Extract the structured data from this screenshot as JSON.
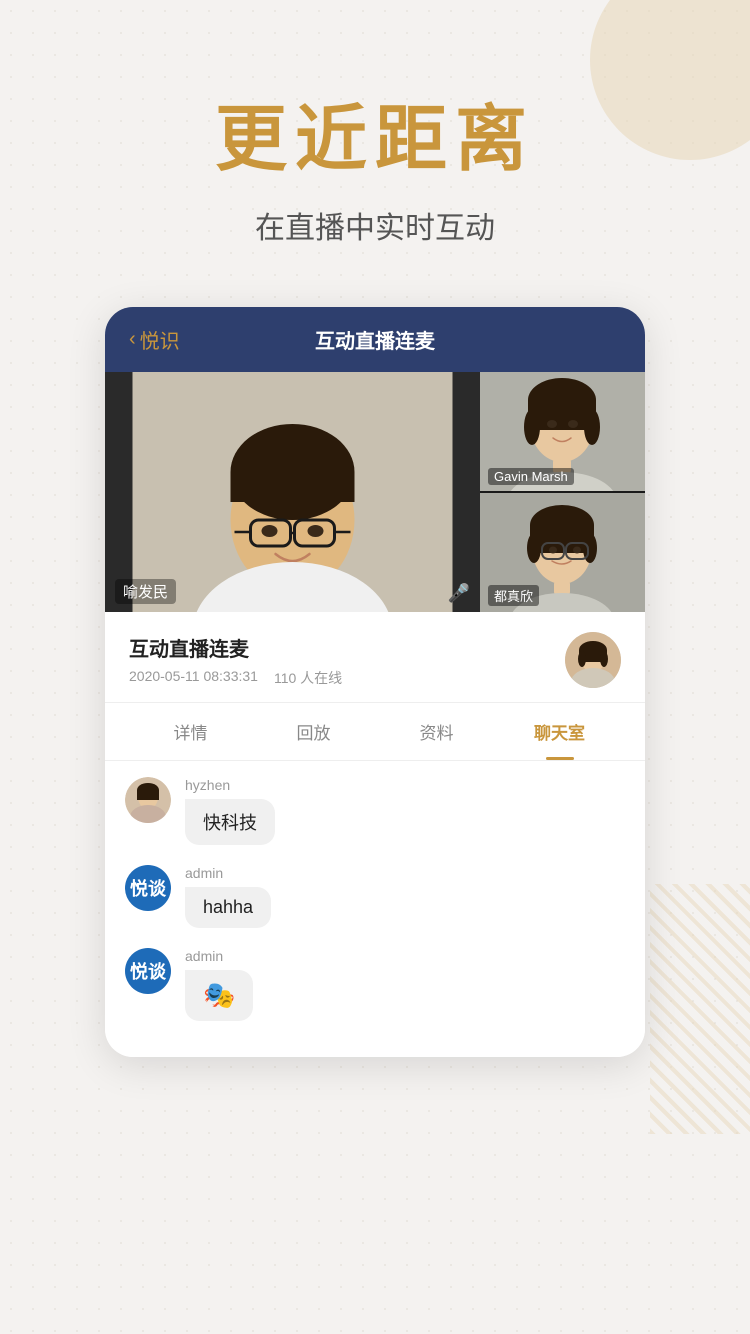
{
  "page": {
    "bg_color": "#f4f2f0"
  },
  "hero": {
    "main_title": "更近距离",
    "sub_title": "在直播中实时互动"
  },
  "card": {
    "header": {
      "back_label": "悦识",
      "title": "互动直播连麦"
    },
    "video": {
      "main_person": {
        "name": "喻发民",
        "has_mic": true
      },
      "side_persons": [
        {
          "name": "Gavin Marsh"
        },
        {
          "name": "都真欣"
        }
      ]
    },
    "info": {
      "title": "互动直播连麦",
      "date": "2020-05-11 08:33:31",
      "online_count": "110 人在线"
    },
    "tabs": [
      {
        "label": "详情",
        "active": false
      },
      {
        "label": "回放",
        "active": false
      },
      {
        "label": "资料",
        "active": false
      },
      {
        "label": "聊天室",
        "active": true
      }
    ],
    "chat": {
      "messages": [
        {
          "avatar_type": "image",
          "username": "hyzhen",
          "text": "快科技",
          "emoji": false
        },
        {
          "avatar_type": "badge",
          "badge_text": "悦谈",
          "username": "admin",
          "text": "hahha",
          "emoji": false
        },
        {
          "avatar_type": "badge",
          "badge_text": "悦谈",
          "username": "admin",
          "text": "🎭",
          "emoji": true
        }
      ]
    }
  }
}
